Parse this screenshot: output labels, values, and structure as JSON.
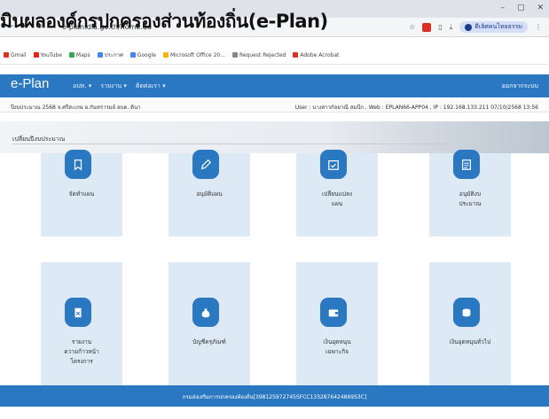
{
  "overlay_title": "มินผลองค์กรปกครองส่วนท้องถิ่น(e-Plan)",
  "browser": {
    "url": "e-plan.dla.go.th/home.do",
    "profile_label": "ดีเลิศคนไทยธรรม",
    "bookmarks": [
      {
        "label": "Gmail",
        "icon": "gmail-icon",
        "color": "#d93025"
      },
      {
        "label": "YouTube",
        "icon": "youtube-icon",
        "color": "#e62117"
      },
      {
        "label": "Maps",
        "icon": "maps-icon",
        "color": "#34a853"
      },
      {
        "label": "ประกาศ",
        "icon": "bookmark-icon",
        "color": "#4285f4"
      },
      {
        "label": "Google",
        "icon": "google-icon",
        "color": "#4285f4"
      },
      {
        "label": "Microsoft Office 20...",
        "icon": "office-icon",
        "color": "#f4b400"
      },
      {
        "label": "Request Rejected",
        "icon": "globe-icon",
        "color": "#888888"
      },
      {
        "label": "Adobe Acrobat",
        "icon": "acrobat-icon",
        "color": "#d93025"
      }
    ]
  },
  "app": {
    "logo": "e-Plan",
    "menu": [
      "อปท.",
      "รายงาน",
      "ติดต่อเรา"
    ],
    "logout": "ออกจากระบบ",
    "info_left": "ปีงบประมาณ 2568 จ.ศรีสะเกษ อ.กันทรารมย์ อบต. ดินา",
    "info_right": "User : นางสาวกัลยาณี สมนึก , Web : EPLAN66-APP04 , IP : 192.168.133.211 07/10/2568 13:56",
    "section_title": "เปลี่ยนปีงบประมาณ"
  },
  "cards_top": [
    {
      "label": "จัดทำแผน",
      "icon": "bookmark-icon"
    },
    {
      "label": "อนุมัติแผน",
      "icon": "pencil-icon"
    },
    {
      "label": "เปลี่ยนแปลง\nแผน",
      "icon": "calendar-check-icon"
    },
    {
      "label": "อนุมัติงบ\nประมาณ",
      "icon": "document-list-icon"
    }
  ],
  "cards_bottom": [
    {
      "label": "รายงาน\nความก้าวหน้า\nโครงการ",
      "icon": "report-icon"
    },
    {
      "label": "บัญชีครุภัณฑ์",
      "icon": "money-bag-icon"
    },
    {
      "label": "เงินอุดหนุน\nเฉพาะกิจ",
      "icon": "wallet-icon"
    },
    {
      "label": "เงินอุดหนุนทั่วไป",
      "icon": "coins-icon"
    }
  ],
  "footer": "กรมส่งเสริมการปกครองท้องถิ่น[398125972745SFCC1332876424869S3C]",
  "colors": {
    "primary": "#2b78c2",
    "card_bg": "#dde9f4"
  }
}
